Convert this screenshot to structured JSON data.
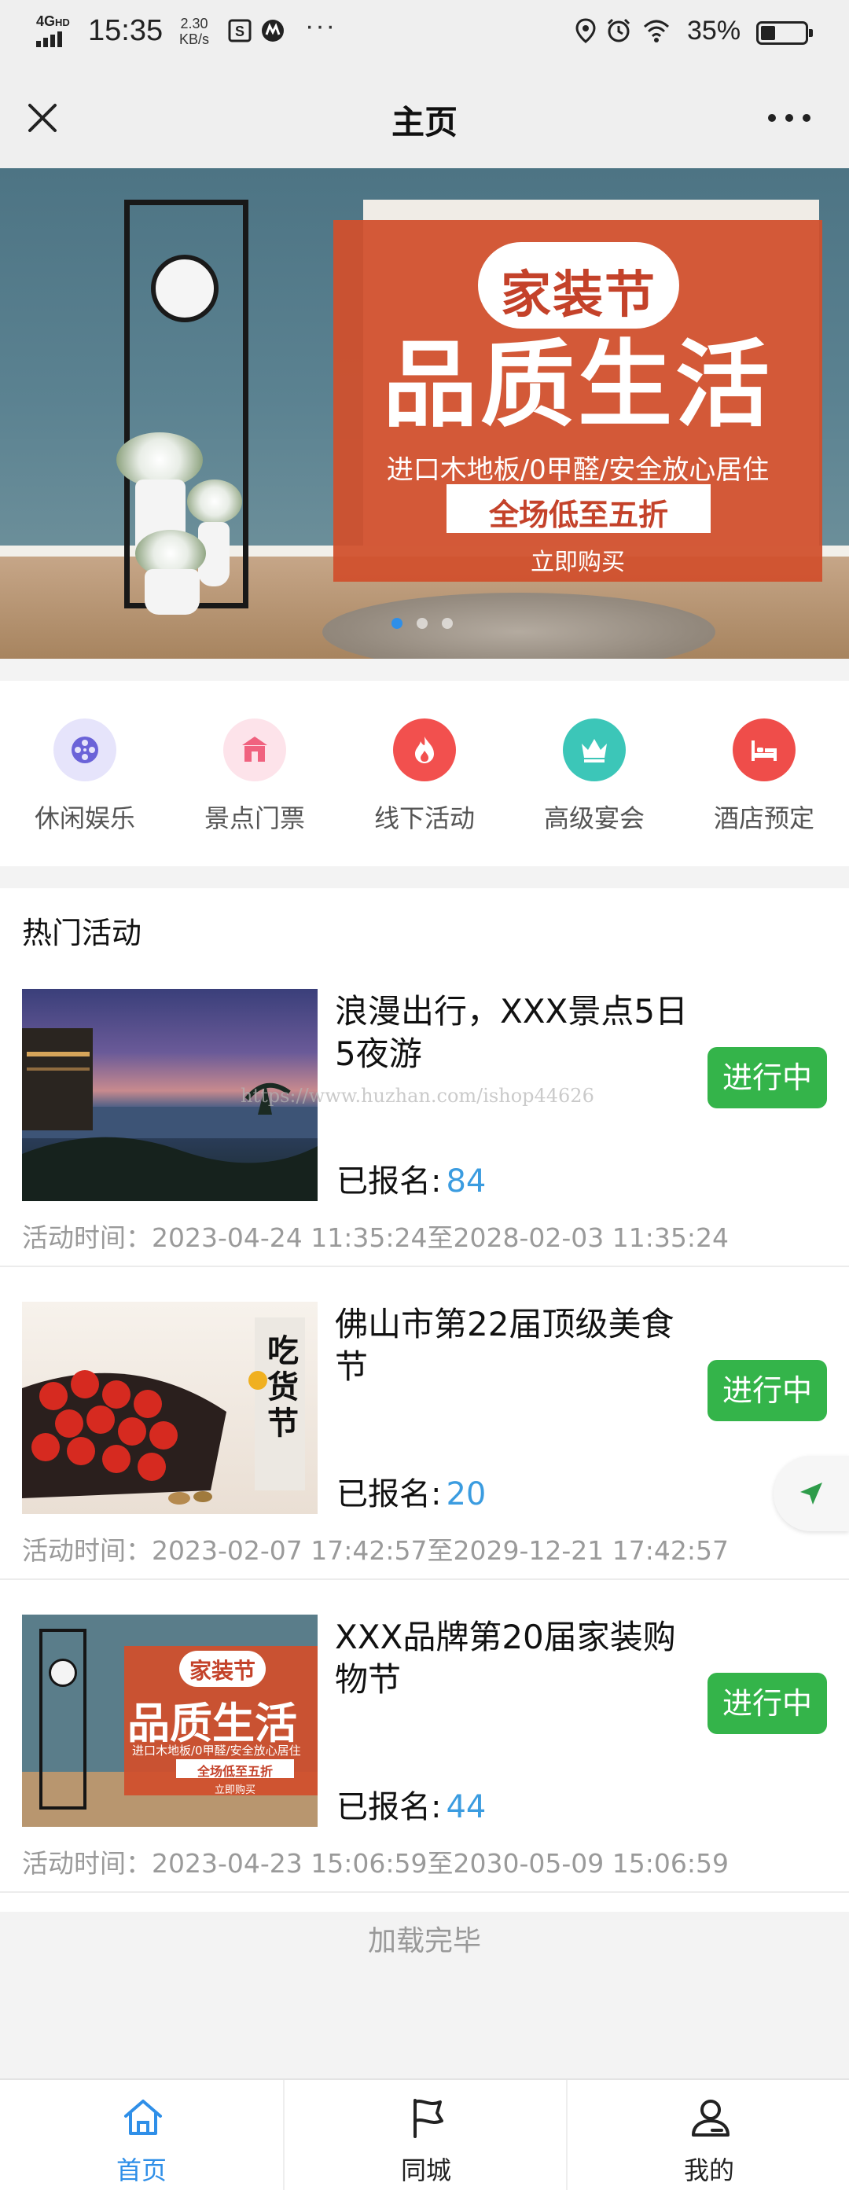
{
  "status_bar": {
    "network": "4G",
    "network_sub": "HD",
    "time": "15:35",
    "speed_value": "2.30",
    "speed_unit": "KB/s",
    "more": "···",
    "battery": "35%"
  },
  "nav": {
    "title": "主页",
    "close_icon": "close-icon",
    "more_icon": "more-icon"
  },
  "banner": {
    "badge": "家装节",
    "headline": "品质生活",
    "subline": "进口木地板/0甲醛/安全放心居住",
    "discount": "全场低至五折",
    "cta": "立即购买",
    "slides": 3,
    "active_slide": 1
  },
  "categories": [
    {
      "label": "休闲娱乐",
      "icon": "film-reel-icon",
      "bg": "#e6e4fb",
      "fg": "#6b63d8"
    },
    {
      "label": "景点门票",
      "icon": "temple-icon",
      "bg": "#fde3ea",
      "fg": "#f0627f"
    },
    {
      "label": "线下活动",
      "icon": "flame-icon",
      "bg": "#f2504e",
      "fg": "#ffffff"
    },
    {
      "label": "高级宴会",
      "icon": "crown-icon",
      "bg": "#3cc6b8",
      "fg": "#ffffff"
    },
    {
      "label": "酒店预定",
      "icon": "bed-icon",
      "bg": "#ef4d4a",
      "fg": "#ffffff"
    }
  ],
  "hot": {
    "title": "热门活动",
    "items": [
      {
        "title": "浪漫出行，XXX景点5日5夜游",
        "status": "进行中",
        "count_label": "已报名:",
        "count": "84",
        "time": "活动时间：2023-04-24 11:35:24至2028-02-03 11:35:24"
      },
      {
        "title": "佛山市第22届顶级美食节",
        "status": "进行中",
        "count_label": "已报名:",
        "count": "20",
        "time": "活动时间：2023-02-07 17:42:57至2029-12-21 17:42:57",
        "thumb_text": "吃货节"
      },
      {
        "title": "XXX品牌第20届家装购物节",
        "status": "进行中",
        "count_label": "已报名:",
        "count": "44",
        "time": "活动时间：2023-04-23 15:06:59至2030-05-09 15:06:59"
      }
    ]
  },
  "watermark": "https://www.huzhan.com/ishop44626",
  "loaded_text": "加载完毕",
  "tabs": [
    {
      "label": "首页",
      "icon": "home-icon",
      "active": true
    },
    {
      "label": "同城",
      "icon": "flag-icon",
      "active": false
    },
    {
      "label": "我的",
      "icon": "user-icon",
      "active": false
    }
  ],
  "colors": {
    "accent": "#2f8fe8",
    "status_green": "#34b44a",
    "count_blue": "#3b9ce0",
    "promo_red": "#d0502d"
  }
}
